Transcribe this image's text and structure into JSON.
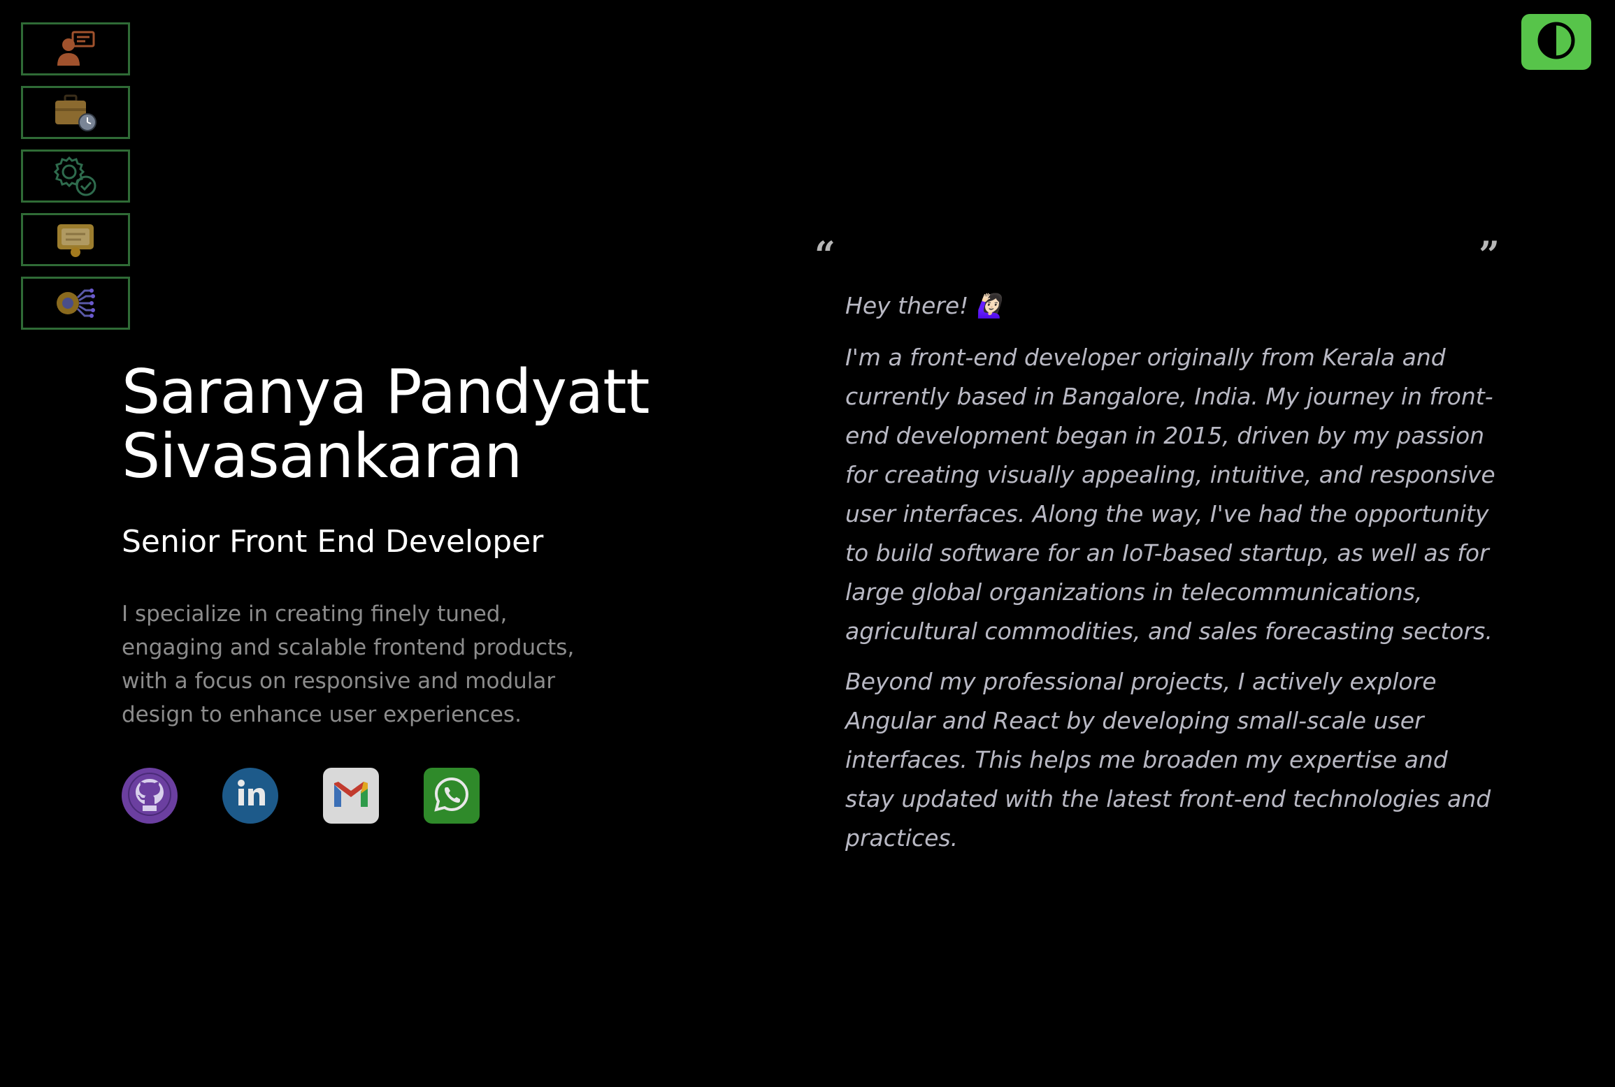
{
  "nav": {
    "items": [
      {
        "name": "about",
        "icon": "presenter-icon"
      },
      {
        "name": "experience",
        "icon": "briefcase-clock-icon"
      },
      {
        "name": "skills",
        "icon": "gear-check-icon"
      },
      {
        "name": "certificates",
        "icon": "certificate-icon"
      },
      {
        "name": "projects",
        "icon": "gear-network-icon"
      }
    ]
  },
  "theme_toggle": {
    "icon": "contrast-icon",
    "color": "#57c44a"
  },
  "hero": {
    "name_line1": "Saranya Pandyatt",
    "name_line2": "Sivasankaran",
    "role": "Senior Front End Developer",
    "summary": "I specialize in creating finely tuned, engaging and scalable frontend products, with a focus on responsive and modular design to enhance user experiences."
  },
  "socials": [
    {
      "name": "github",
      "icon": "github-icon",
      "color": "#6b3fa0"
    },
    {
      "name": "linkedin",
      "icon": "linkedin-icon",
      "color": "#1d5a8a"
    },
    {
      "name": "gmail",
      "icon": "gmail-icon",
      "color": "#d9d9d9"
    },
    {
      "name": "whatsapp",
      "icon": "whatsapp-icon",
      "color": "#2f8a2a"
    }
  ],
  "about": {
    "open_quote": "“",
    "close_quote": "”",
    "greeting": "Hey there! 🙋🏻‍♀️",
    "paragraph1": "I'm a front-end developer originally from Kerala and currently based in Bangalore, India. My journey in front-end development began in 2015, driven by my passion for creating visually appealing, intuitive, and responsive user interfaces. Along the way, I've had the opportunity to build software for an IoT-based startup, as well as for large global organizations in telecommunications, agricultural commodities, and sales forecasting sectors.",
    "paragraph2": "Beyond my professional projects, I actively explore Angular and React by developing small-scale user interfaces. This helps me broaden my expertise and stay updated with the latest front-end technologies and practices."
  }
}
